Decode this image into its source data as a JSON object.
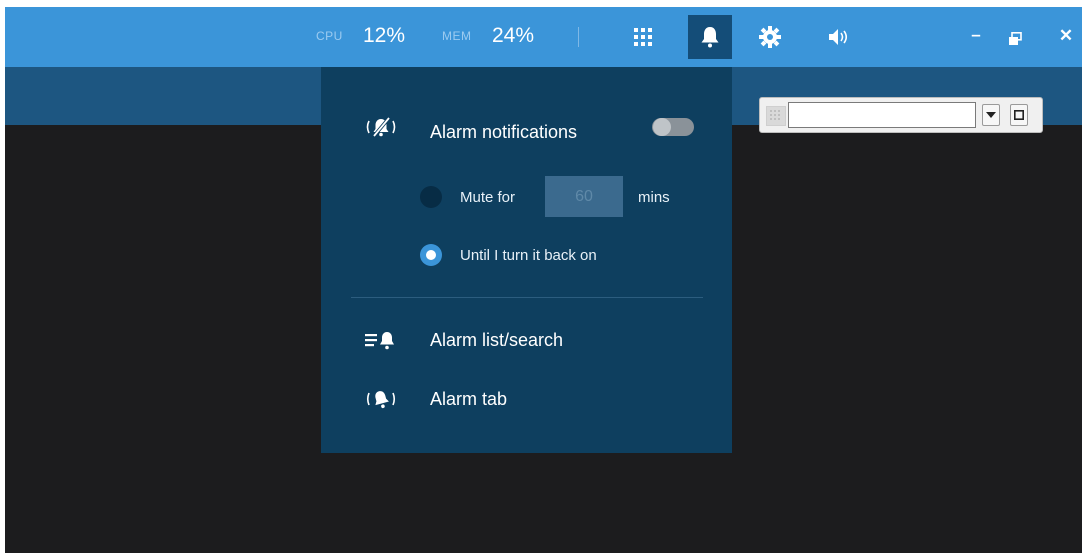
{
  "topbar": {
    "cpu_label": "CPU",
    "cpu_value": "12%",
    "mem_label": "MEM",
    "mem_value": "24%",
    "icons": [
      "grid-icon",
      "bell-icon",
      "gear-icon",
      "speaker-icon"
    ],
    "active_icon": "bell-icon",
    "window_controls": [
      "minimize-icon",
      "restore-icon",
      "close-icon"
    ]
  },
  "mini_toolbar": {
    "input_value": "",
    "buttons": [
      "chevron-down-icon",
      "maximize-icon"
    ]
  },
  "alarm_panel": {
    "notifications_label": "Alarm notifications",
    "notifications_enabled": false,
    "mute_for_label": "Mute for",
    "mute_minutes_placeholder": "60",
    "mins_label": "mins",
    "until_label": "Until I turn it back on",
    "selected_option": "until",
    "list_search_label": "Alarm list/search",
    "alarm_tab_label": "Alarm tab"
  },
  "colors": {
    "topbar": "#3b95d9",
    "subbar": "#1d5681",
    "panel": "#0e3f5f",
    "workspace": "#1c1c1e",
    "accent": "#3b95d9"
  }
}
